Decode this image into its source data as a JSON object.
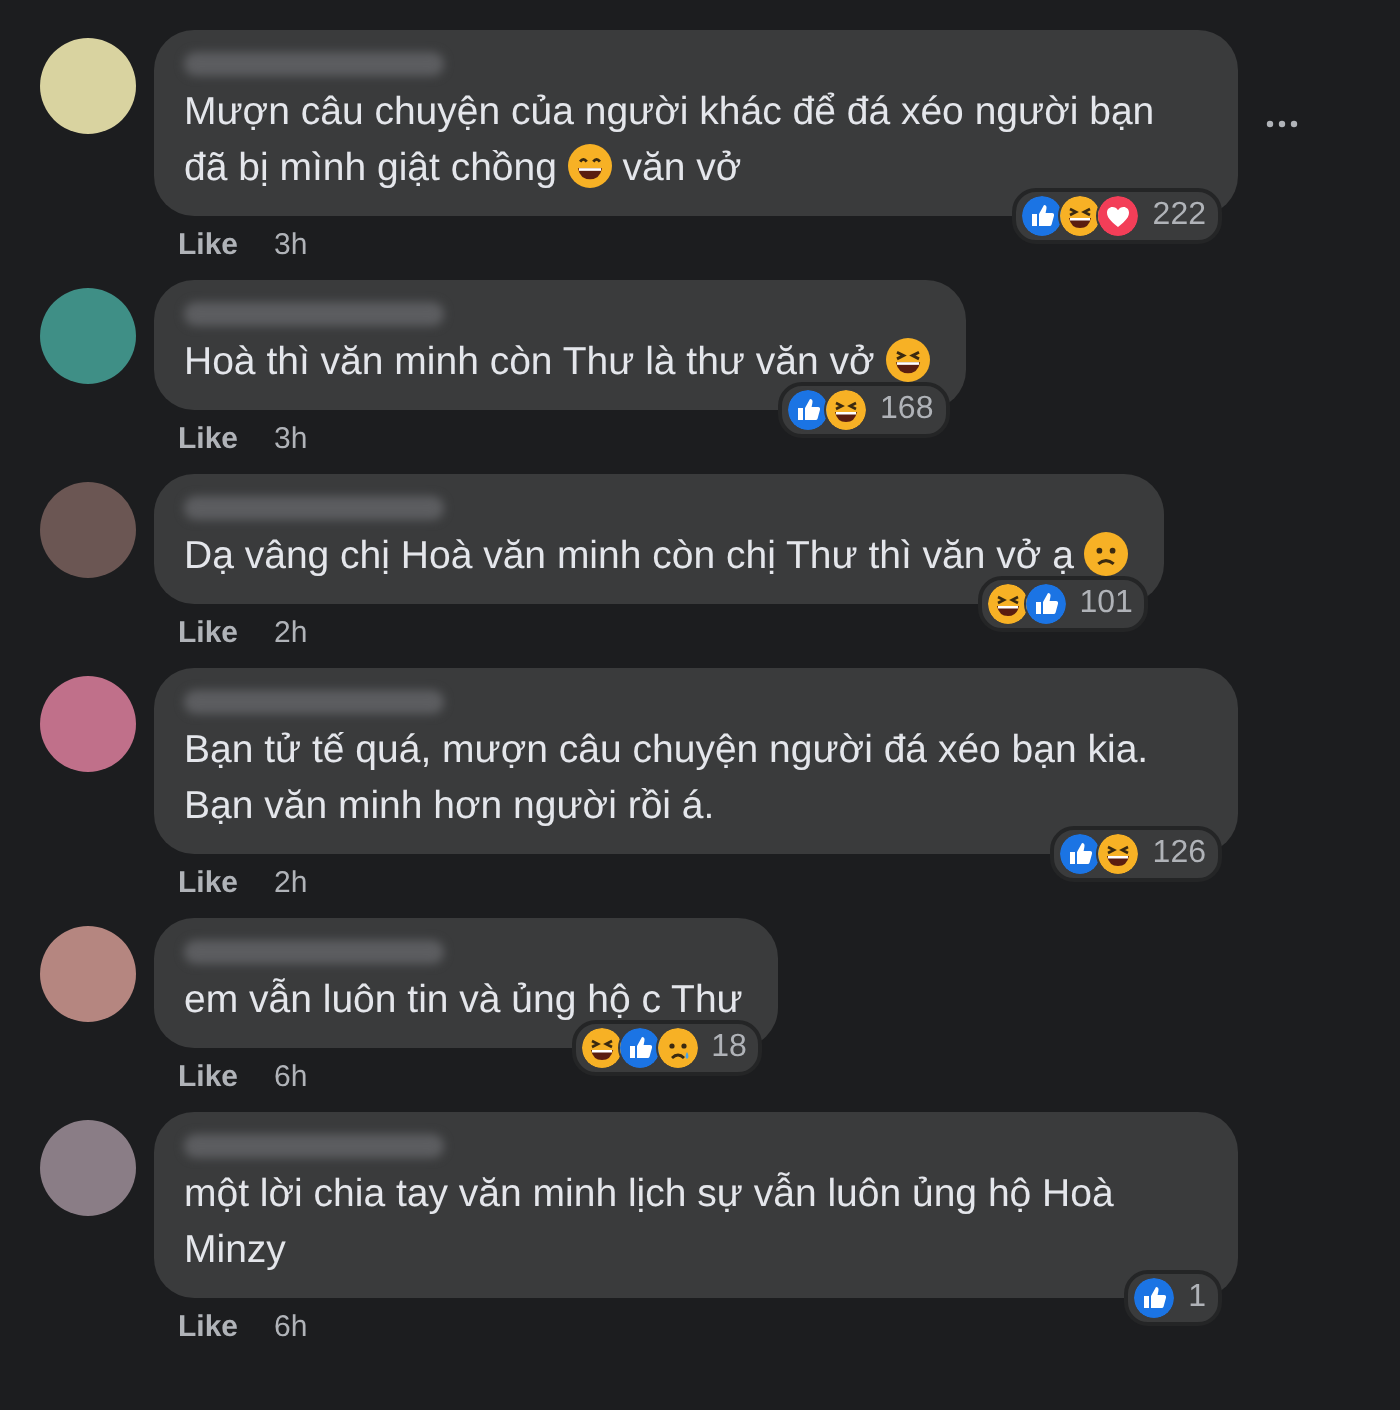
{
  "comments": [
    {
      "color": "#d9d3a0",
      "body": [
        {
          "kind": "text",
          "text": "Mượn câu chuyện của người khác để đá xéo người bạn đã bị mình giật chồng "
        },
        {
          "kind": "grin"
        },
        {
          "kind": "text",
          "text": " văn vở"
        }
      ],
      "reactions": [
        {
          "kind": "like"
        },
        {
          "kind": "haha"
        },
        {
          "kind": "love"
        }
      ],
      "reaction_count": "222",
      "like": "Like",
      "time": "3h",
      "menu": true
    },
    {
      "color": "#3f8f86",
      "body": [
        {
          "kind": "text",
          "text": "Hoà thì văn minh còn Thư là thư văn vở "
        },
        {
          "kind": "laugh"
        }
      ],
      "reactions": [
        {
          "kind": "like"
        },
        {
          "kind": "haha"
        }
      ],
      "reaction_count": "168",
      "like": "Like",
      "time": "3h",
      "menu": false
    },
    {
      "color": "#6b5653",
      "body": [
        {
          "kind": "text",
          "text": "Dạ vâng chị Hoà văn minh còn chị Thư thì văn vở ạ "
        },
        {
          "kind": "frown"
        }
      ],
      "reactions": [
        {
          "kind": "haha"
        },
        {
          "kind": "like"
        }
      ],
      "reaction_count": "101",
      "like": "Like",
      "time": "2h",
      "menu": false
    },
    {
      "color": "#c0708a",
      "body": [
        {
          "kind": "text",
          "text": "Bạn tử tế quá, mượn câu chuyện người đá xéo bạn kia. Bạn văn minh hơn người rồi á."
        }
      ],
      "reactions": [
        {
          "kind": "like"
        },
        {
          "kind": "haha"
        }
      ],
      "reaction_count": "126",
      "like": "Like",
      "time": "2h",
      "menu": false
    },
    {
      "color": "#b58680",
      "body": [
        {
          "kind": "text",
          "text": "em vẫn luôn tin và ủng hộ c Thư"
        }
      ],
      "reactions": [
        {
          "kind": "haha"
        },
        {
          "kind": "like"
        },
        {
          "kind": "sad"
        }
      ],
      "reaction_count": "18",
      "like": "Like",
      "time": "6h",
      "menu": false
    },
    {
      "color": "#8a7d86",
      "body": [
        {
          "kind": "text",
          "text": "một lời chia tay văn minh lịch sự vẫn luôn ủng hộ Hoà Minzy"
        }
      ],
      "reactions": [
        {
          "kind": "like"
        }
      ],
      "reaction_count": "1",
      "like": "Like",
      "time": "6h",
      "menu": false
    }
  ]
}
